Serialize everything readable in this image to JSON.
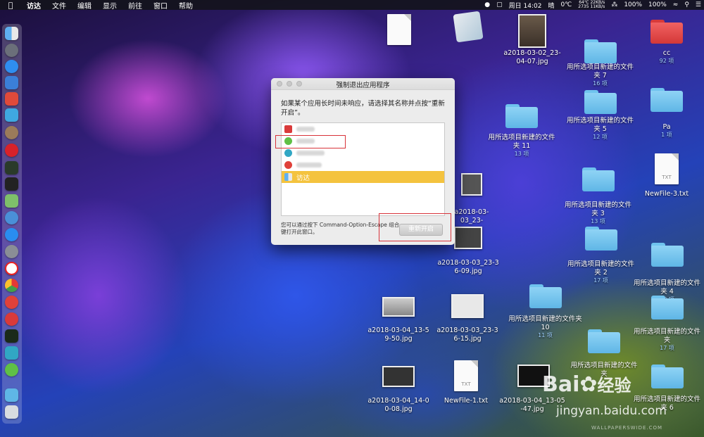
{
  "menubar": {
    "app_name": "访达",
    "items": [
      "文件",
      "编辑",
      "显示",
      "前往",
      "窗口",
      "帮助"
    ],
    "status_top": "64℃ 22KB/s",
    "status_bottom": "2735 11KB/s",
    "battery_1": "100%",
    "battery_2": "100%",
    "datetime": "周日 14:02",
    "weather": "晴",
    "temperature": "0℃"
  },
  "dock": {
    "icons": [
      "finder-icon",
      "launchpad-icon",
      "safari-icon",
      "preview-icon",
      "music-icon",
      "migration-icon",
      "photo-icon",
      "netease-music-icon",
      "activity-icon",
      "terminal-icon",
      "maps-icon",
      "mail-icon",
      "appstore-icon",
      "settings-icon",
      "yandex-icon",
      "chrome-icon",
      "weibo-icon",
      "vivaldi-icon",
      "iterm-icon",
      "wechat-helper-icon",
      "wechat-icon",
      "folder-icon",
      "trash-icon"
    ]
  },
  "dialog": {
    "title": "强制退出应用程序",
    "message": "如果某个应用长时间未响应，请选择其名称并点按“重新开启”。",
    "apps": [
      {
        "name": "",
        "color": "#d93a3a",
        "selected": false
      },
      {
        "name": "",
        "color": "#5fc046",
        "selected": false
      },
      {
        "name": "",
        "color": "#31a7c4",
        "selected": false
      },
      {
        "name": "",
        "color": "#e0413a",
        "selected": false
      },
      {
        "name": "访达",
        "color": "#3f8fe0",
        "selected": true
      }
    ],
    "hint": "您可以通过按下 Command-Option-Escape 组合键打开此窗口。",
    "button_label": "重新开启"
  },
  "desktop": {
    "items": [
      {
        "label": "",
        "sub": "",
        "kind": "doc"
      },
      {
        "label": "",
        "sub": "",
        "kind": "app"
      },
      {
        "label": "a2018-03-02_23-04-07.jpg",
        "sub": "",
        "kind": "image"
      },
      {
        "label": "cc",
        "sub": "92 项",
        "kind": "folder-red"
      },
      {
        "label": "用所选项目新建的文件夹 7",
        "sub": "16 项",
        "kind": "folder"
      },
      {
        "label": "用所选项目新建的文件夹 5",
        "sub": "12 项",
        "kind": "folder"
      },
      {
        "label": "Pa",
        "sub": "1 项",
        "kind": "folder"
      },
      {
        "label": "用所选项目新建的文件夹 11",
        "sub": "13 项",
        "kind": "folder"
      },
      {
        "label": "NewFile-3.txt",
        "sub": "",
        "kind": "doc"
      },
      {
        "label": "用所选项目新建的文件夹 3",
        "sub": "13 项",
        "kind": "folder"
      },
      {
        "label": "a2018-03-03_23-",
        "sub": "",
        "kind": "image"
      },
      {
        "label": "a2018-03-03_23-36-09.jpg",
        "sub": "",
        "kind": "image"
      },
      {
        "label": "用所选项目新建的文件夹 2",
        "sub": "17 项",
        "kind": "folder"
      },
      {
        "label": "用所选项目新建的文件夹 4",
        "sub": "18 项",
        "kind": "folder"
      },
      {
        "label": "用所选项目新建的文件夹 10",
        "sub": "11 项",
        "kind": "folder"
      },
      {
        "label": "用所选项目新建的文件夹",
        "sub": "17 项",
        "kind": "folder"
      },
      {
        "label": "a2018-03-04_13-59-50.jpg",
        "sub": "",
        "kind": "image"
      },
      {
        "label": "a2018-03-03_23-36-15.jpg",
        "sub": "",
        "kind": "image"
      },
      {
        "label": "用所选项目新建的文件夹",
        "sub": "",
        "kind": "folder"
      },
      {
        "label": "a2018-03-04_14-00-08.jpg",
        "sub": "",
        "kind": "image"
      },
      {
        "label": "NewFile-1.txt",
        "sub": "",
        "kind": "doc"
      },
      {
        "label": "a2018-03-04_13-05-47.jpg",
        "sub": "",
        "kind": "image"
      },
      {
        "label": "用所选项目新建的文件夹 6",
        "sub": "",
        "kind": "folder"
      }
    ],
    "doc_badge": "TXT"
  },
  "watermark": {
    "brand": "Bai",
    "brand_cn": "经验",
    "url": "jingyan.baidu.com",
    "source": "WALLPAPERSWIDE.COM"
  }
}
